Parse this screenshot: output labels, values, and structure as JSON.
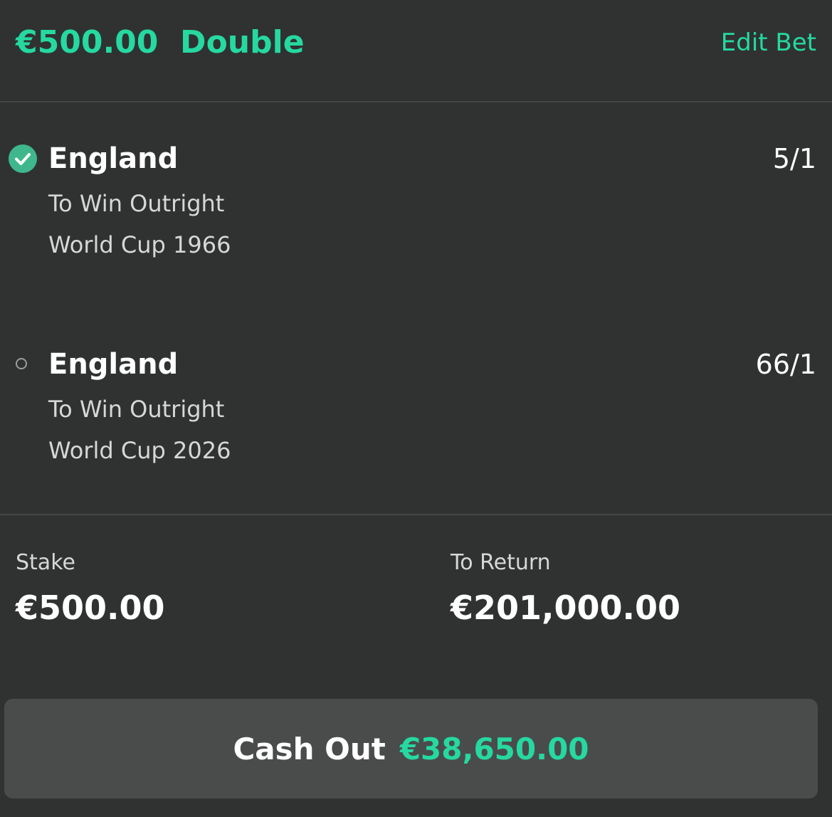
{
  "header": {
    "title": "€500.00  Double",
    "edit_label": "Edit Bet"
  },
  "selections": [
    {
      "status": "won",
      "status_icon": "check-circle-icon",
      "name": "England",
      "odds": "5/1",
      "market": "To Win Outright",
      "event": "World Cup 1966"
    },
    {
      "status": "open",
      "status_icon": "open-circle-icon",
      "name": "England",
      "odds": "66/1",
      "market": "To Win Outright",
      "event": "World Cup 2026"
    }
  ],
  "summary": {
    "stake_label": "Stake",
    "stake_value": "€500.00",
    "return_label": "To Return",
    "return_value": "€201,000.00"
  },
  "cashout": {
    "label": "Cash Out",
    "amount": "€38,650.00"
  },
  "colors": {
    "background": "#303232",
    "accent": "#25d9a0",
    "check_icon": "#3fb78d",
    "button": "#4a4c4c"
  }
}
